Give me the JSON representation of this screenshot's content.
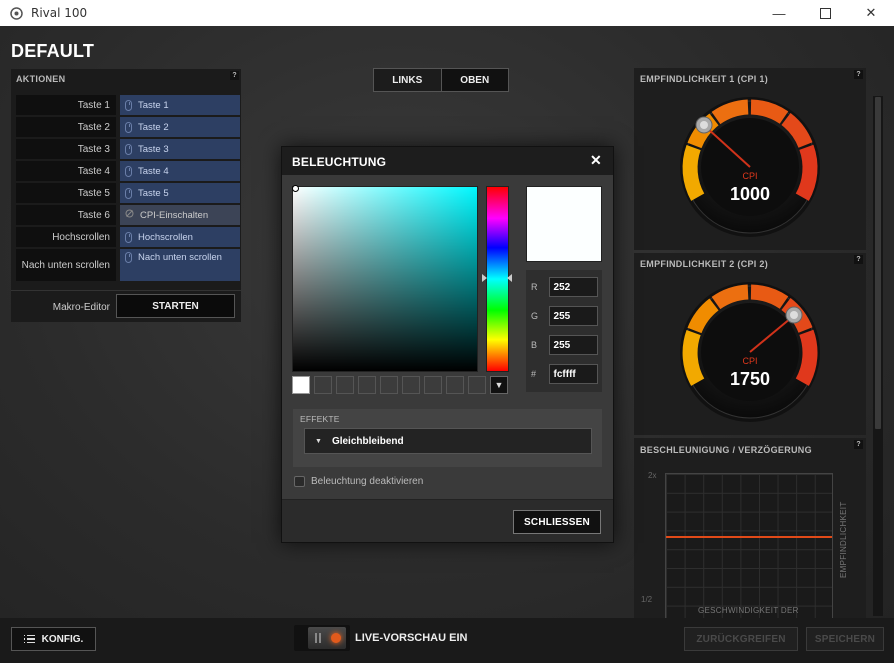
{
  "window": {
    "title": "Rival 100",
    "minimize": "—",
    "maximize": "☐",
    "close": "✕"
  },
  "profile": {
    "name": "DEFAULT"
  },
  "actions": {
    "heading": "AKTIONEN",
    "help": "?",
    "rows": [
      {
        "label": "Taste 1",
        "value": "Taste 1"
      },
      {
        "label": "Taste 2",
        "value": "Taste 2"
      },
      {
        "label": "Taste 3",
        "value": "Taste 3"
      },
      {
        "label": "Taste 4",
        "value": "Taste 4"
      },
      {
        "label": "Taste 5",
        "value": "Taste 5"
      },
      {
        "label": "Taste 6",
        "value": "CPI-Einschalten"
      },
      {
        "label": "Hochscrollen",
        "value": "Hochscrollen"
      },
      {
        "label": "Nach unten scrollen",
        "value": "Nach unten scrollen"
      }
    ],
    "macro_label": "Makro-Editor",
    "macro_button": "STARTEN"
  },
  "side_tabs": {
    "left": "LINKS",
    "top": "OBEN"
  },
  "sensitivity": [
    {
      "heading": "EMPFINDLICHKEIT 1 (CPI 1)",
      "unit": "CPI",
      "value": "1000",
      "help": "?"
    },
    {
      "heading": "EMPFINDLICHKEIT 2 (CPI 2)",
      "unit": "CPI",
      "value": "1750",
      "help": "?"
    }
  ],
  "acceleration": {
    "heading": "BESCHLEUNIGUNG / VERZÖGERUNG",
    "help": "?",
    "y_top": "2x",
    "y_bottom": "1/2",
    "v_label": "EMPFINDLICHKEIT",
    "h_label": "GESCHWINDIGKEIT DER"
  },
  "bottom": {
    "config": "KONFIG.",
    "live_preview": "LIVE-VORSCHAU EIN",
    "revert": "ZURÜCKGREIFEN",
    "save": "SPEICHERN"
  },
  "lighting_dialog": {
    "title": "BELEUCHTUNG",
    "close_icon": "✕",
    "rgb": {
      "r_label": "R",
      "r": "252",
      "g_label": "G",
      "g": "255",
      "b_label": "B",
      "b": "255",
      "hex_label": "#",
      "hex": "fcffff"
    },
    "effects_label": "EFFEKTE",
    "effect": "Gleichbleibend",
    "disable_label": "Beleuchtung deaktivieren",
    "close_button": "SCHLIESSEN",
    "colors": {
      "preview": "#fcffff"
    }
  },
  "colors": {
    "accent": "#e24a18",
    "live_dot": "#e25a1c",
    "action_button": "#2d3f63"
  }
}
